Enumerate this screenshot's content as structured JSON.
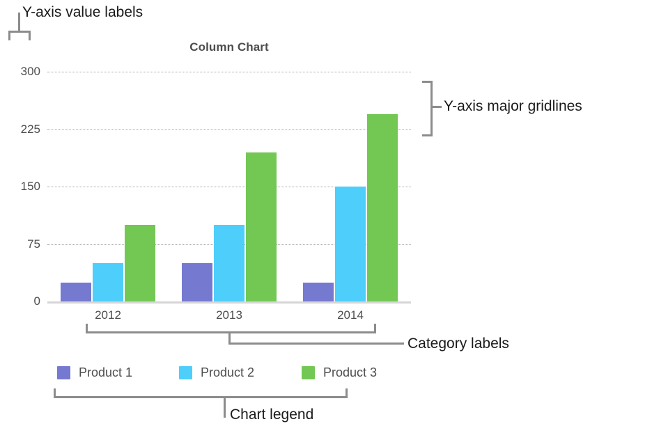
{
  "chart_data": {
    "type": "bar",
    "title": "Column Chart",
    "xlabel": "",
    "ylabel": "",
    "categories": [
      "2012",
      "2013",
      "2014"
    ],
    "series": [
      {
        "name": "Product 1",
        "color": "#7579d0",
        "values": [
          25,
          50,
          25
        ]
      },
      {
        "name": "Product 2",
        "color": "#4ecefa",
        "values": [
          50,
          100,
          150
        ]
      },
      {
        "name": "Product 3",
        "color": "#72c853",
        "values": [
          100,
          195,
          245
        ]
      }
    ],
    "ylim": [
      0,
      300
    ],
    "yticks": [
      300,
      225,
      150,
      75,
      0
    ],
    "ytick_labels": [
      "300",
      "225",
      "150",
      "75",
      "0"
    ],
    "grid": true,
    "grid_axis": "y",
    "grid_style": "dotted",
    "legend_position": "bottom-left",
    "bar_grouping": "grouped"
  },
  "annotations": [
    {
      "id": "y-axis-value-labels",
      "label": "Y-axis value labels"
    },
    {
      "id": "y-axis-major-gridlines",
      "label": "Y-axis major gridlines"
    },
    {
      "id": "category-labels",
      "label": "Category labels"
    },
    {
      "id": "chart-legend",
      "label": "Chart legend"
    }
  ],
  "colors": {
    "product1": "#7579d0",
    "product2": "#4ecefa",
    "product3": "#72c853",
    "gridline": "#a6a6a6",
    "axis": "#d6d6d6",
    "annotation_bracket": "#8c8c8c",
    "text": "#4d4d4d",
    "annotation_text": "#1a1a1a"
  }
}
